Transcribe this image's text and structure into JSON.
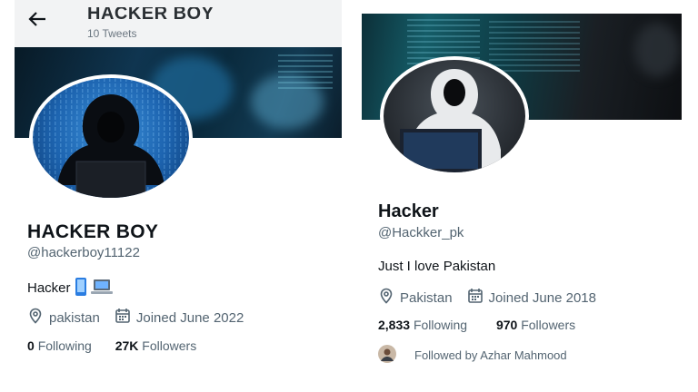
{
  "left_profile": {
    "header_name": "HACKER BOY",
    "header_tweets": "10 Tweets",
    "name": "HACKER BOY",
    "handle": "@hackerboy11122",
    "bio": "Hacker",
    "location": "pakistan",
    "joined": "Joined June 2022",
    "following_count": "0",
    "following_label": "Following",
    "followers_count": "27K",
    "followers_label": "Followers"
  },
  "right_profile": {
    "name": "Hacker",
    "handle": "@Hackker_pk",
    "bio": "Just I love Pakistan",
    "location": "Pakistan",
    "joined": "Joined June 2018",
    "following_count": "2,833",
    "following_label": "Following",
    "followers_count": "970",
    "followers_label": "Followers",
    "followed_by": "Followed by Azhar Mahmood"
  },
  "icons": [
    "back-arrow-icon",
    "location-pin-icon",
    "calendar-icon",
    "phone-emoji-icon",
    "laptop-emoji-icon"
  ],
  "colors": {
    "text": "#0f1419",
    "secondary": "#536471",
    "header_bg": "#f2f3f4"
  }
}
